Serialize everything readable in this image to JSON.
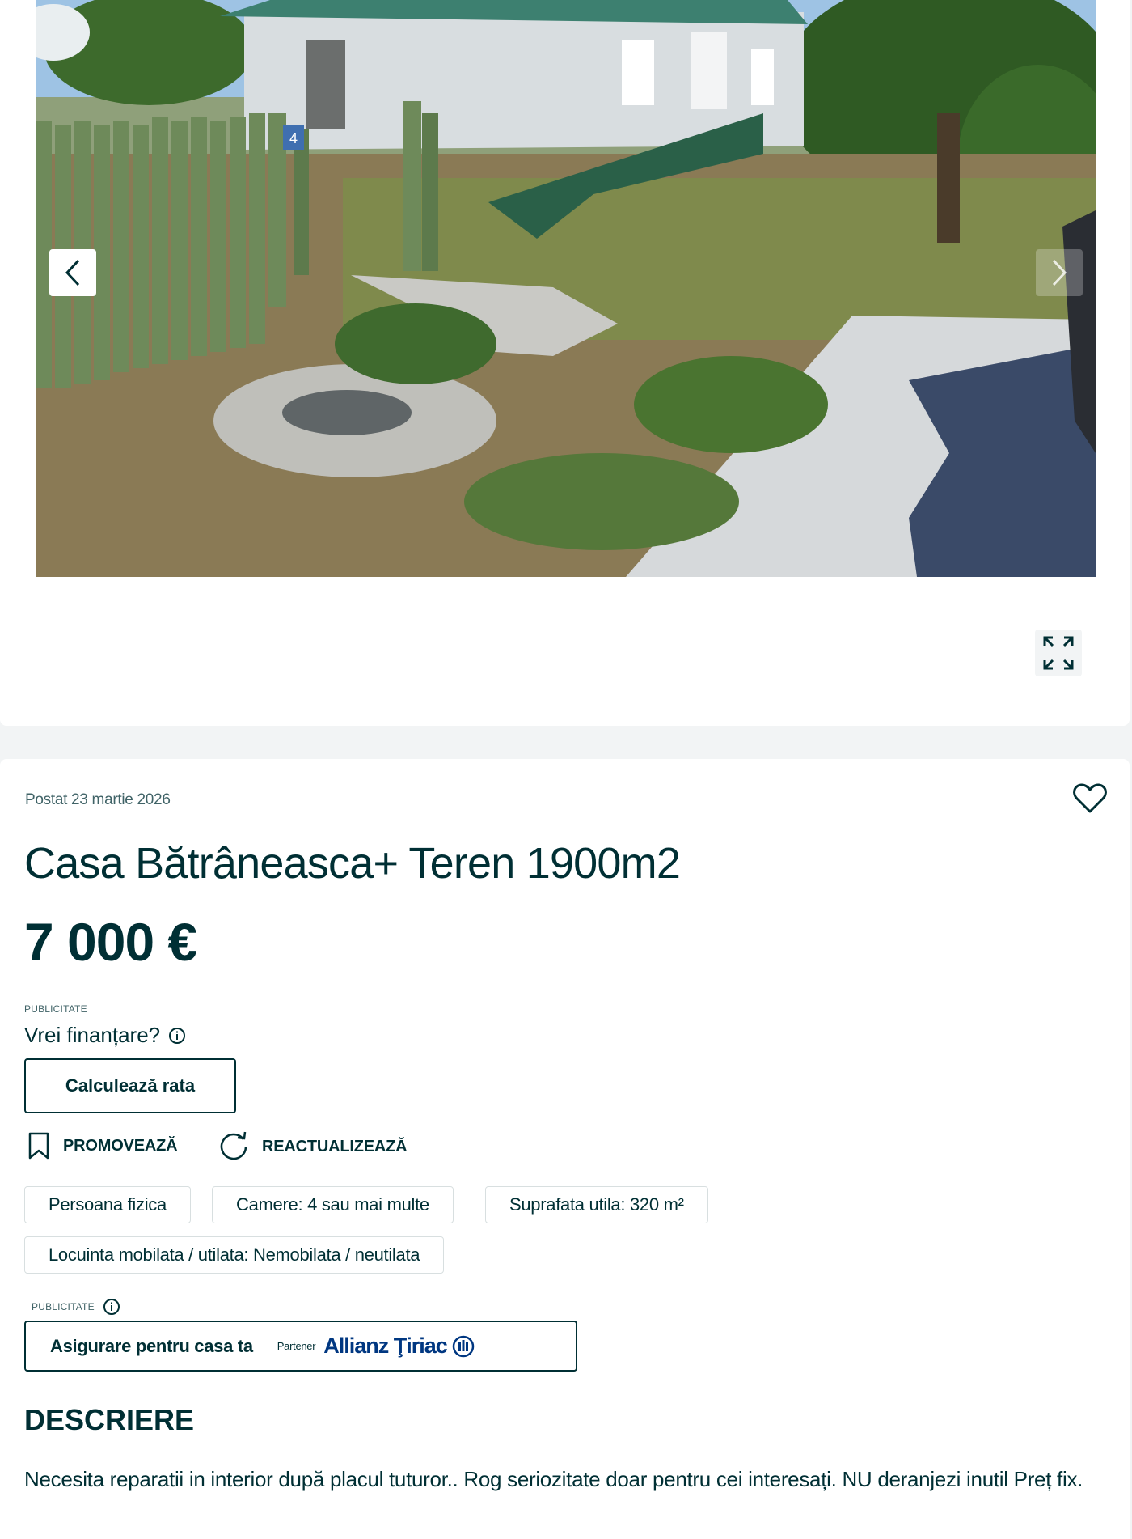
{
  "gallery": {
    "prev_icon": "chevron-left-icon",
    "next_icon": "chevron-right-icon",
    "expand_icon": "expand-icon",
    "house_number": "4"
  },
  "listing": {
    "posted": "Postat 23 martie 2026",
    "title": "Casa Bătrâneasca+ Teren 1900m2",
    "price": "7 000 €",
    "favorite_icon": "heart-icon"
  },
  "financing": {
    "ad_label": "PUBLICITATE",
    "question": "Vrei finanțare?",
    "info_icon": "info-icon",
    "button_label": "Calculează rata"
  },
  "actions": {
    "promote_label": "PROMOVEAZĂ",
    "promote_icon": "bookmark-icon",
    "refresh_label": "REACTUALIZEAZĂ",
    "refresh_icon": "refresh-icon"
  },
  "tags": [
    "Persoana fizica",
    "Camere: 4 sau mai multe",
    "Suprafata utila: 320 m²",
    "Locuinta mobilata / utilata: Nemobilata / neutilata"
  ],
  "insurance": {
    "ad_label": "PUBLICITATE",
    "label": "Asigurare pentru casa ta",
    "partner_label": "Partener",
    "brand": "Allianz Ţiriac"
  },
  "description": {
    "heading": "DESCRIERE",
    "text": "Necesita reparatii in interior după placul tuturor.. Rog seriozitate doar pentru cei interesați. NU deranjezi inutil Preț fix."
  },
  "colors": {
    "text_primary": "#002f34",
    "text_secondary": "#406367",
    "border_light": "#d8dfe0",
    "page_bg": "#f2f4f5",
    "brand_blue": "#003781"
  }
}
